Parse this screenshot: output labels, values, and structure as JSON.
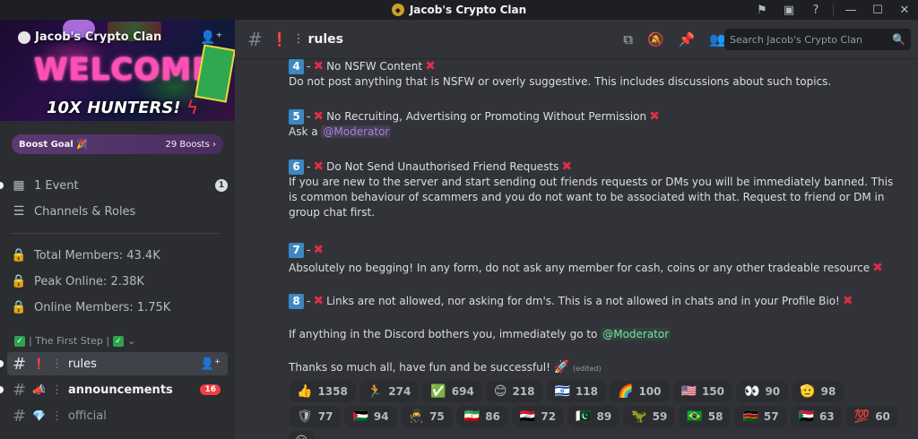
{
  "window": {
    "title": "Jacob's Crypto Clan",
    "controls": [
      "flag-icon",
      "screen-icon",
      "help-icon",
      "minimize-icon",
      "maximize-icon",
      "close-icon"
    ]
  },
  "server": {
    "name": "Jacob's Crypto Clan",
    "banner_text": "WELCOME",
    "banner_subtext": "10X HUNTERS!",
    "boost_goal": "Boost Goal 🎉",
    "boost_count": "29 Boosts ›"
  },
  "sidebar": {
    "event": {
      "label": "1 Event",
      "count": "1"
    },
    "channels_roles": "Channels & Roles",
    "stats": [
      {
        "label": "Total Members: 43.4K"
      },
      {
        "label": "Peak Online: 2.38K"
      },
      {
        "label": "Online Members: 1.75K"
      }
    ],
    "category": "| The First Step |",
    "channels": [
      {
        "emoji": "❗",
        "label": "rules",
        "active": true
      },
      {
        "emoji": "📣",
        "label": "announcements",
        "mentions": "16"
      },
      {
        "emoji": "💎",
        "label": "official"
      }
    ]
  },
  "header": {
    "channel_emoji": "❗",
    "channel_name": "rules",
    "search_placeholder": "Search Jacob's Crypto Clan"
  },
  "rules": [
    {
      "num": "4",
      "title": "No NSFW Content",
      "body": "Do not post anything that is NSFW or overly suggestive. This includes discussions about such topics."
    },
    {
      "num": "5",
      "title": "No Recruiting, Advertising or Promoting Without Permission",
      "body_prefix": "Ask a",
      "mention": "@Moderator"
    },
    {
      "num": "6",
      "title": "Do Not Send Unauthorised Friend Requests",
      "body": "If you are new to the server and start sending out friends requests or DMs you will be immediately banned. This is common behaviour of scammers and you do not want to be associated with that. Request to friend or DM in group chat first."
    },
    {
      "num": "7",
      "title": "Absolutely no begging! In any form, do not ask any member for cash, coins or any other tradeable resource"
    },
    {
      "num": "8",
      "title": "Links are not allowed, nor asking for dm's. This is a not allowed in chats and in your Profile Bio!"
    }
  ],
  "closing": {
    "line1_prefix": "If anything in the Discord bothers you, immediately go to",
    "line1_mention": "@Moderator",
    "line2": "Thanks so much all, have fun and be successful!",
    "edited": "(edited)"
  },
  "reactions": [
    {
      "emoji": "👍",
      "count": "1358"
    },
    {
      "emoji": "🏃",
      "count": "274"
    },
    {
      "emoji": "✅",
      "count": "694"
    },
    {
      "emoji": "😊",
      "count": "218"
    },
    {
      "emoji": "🇮🇱",
      "count": "118"
    },
    {
      "emoji": "🌈",
      "count": "100"
    },
    {
      "emoji": "🇺🇸",
      "count": "150"
    },
    {
      "emoji": "👀",
      "count": "90"
    },
    {
      "emoji": "🫡",
      "count": "98"
    },
    {
      "emoji": "🛡",
      "count": "77"
    },
    {
      "emoji": "🇵🇸",
      "count": "94"
    },
    {
      "emoji": "🥷",
      "count": "75"
    },
    {
      "emoji": "🇮🇷",
      "count": "86"
    },
    {
      "emoji": "🇮🇶",
      "count": "72"
    },
    {
      "emoji": "🇵🇰",
      "count": "89"
    },
    {
      "emoji": "🦖",
      "count": "59"
    },
    {
      "emoji": "🇧🇷",
      "count": "58"
    },
    {
      "emoji": "🇰🇪",
      "count": "57"
    },
    {
      "emoji": "🇸🇩",
      "count": "63"
    },
    {
      "emoji": "💯",
      "count": "60"
    }
  ]
}
